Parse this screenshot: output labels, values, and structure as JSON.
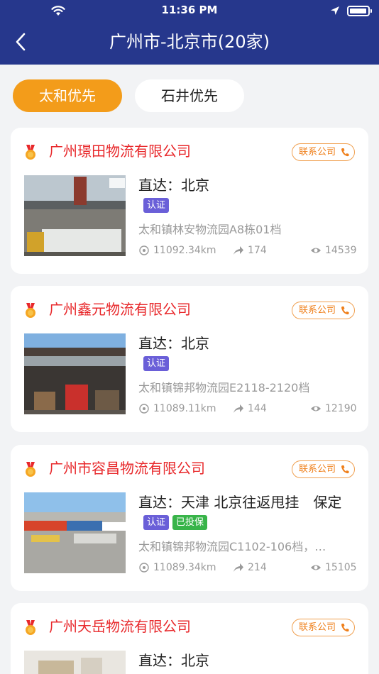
{
  "status_bar": {
    "time": "11:36 PM"
  },
  "header": {
    "title": "广州市-北京市(20家)"
  },
  "tabs": [
    {
      "label": "太和优先",
      "active": true
    },
    {
      "label": "石井优先",
      "active": false
    }
  ],
  "colors": {
    "header": "#26378c",
    "accent": "#f39c1a",
    "company_name": "#e8282b",
    "cert_badge": "#6a5fd8",
    "insured_badge": "#38b449"
  },
  "icons": {
    "back": "chevron-left-icon",
    "medal": "medal-icon",
    "phone": "phone-icon",
    "distance": "location-target-icon",
    "share": "share-arrow-icon",
    "views": "eye-icon"
  },
  "contact_label": "联系公司",
  "companies": [
    {
      "name": "广州璟田物流有限公司",
      "route": "直达：北京",
      "badges": [
        "认证"
      ],
      "address": "太和镇林安物流园A8栋01档",
      "distance": "11092.34km",
      "shares": "174",
      "views": "14539"
    },
    {
      "name": "广州鑫元物流有限公司",
      "route": "直达：北京",
      "badges": [
        "认证"
      ],
      "address": "太和镇锦邦物流园E2118-2120档",
      "distance": "11089.11km",
      "shares": "144",
      "views": "12190"
    },
    {
      "name": "广州市容昌物流有限公司",
      "route": "直达：天津 北京往返甩挂　保定",
      "badges": [
        "认证",
        "已投保"
      ],
      "address": "太和镇锦邦物流园C1102-106档，…",
      "distance": "11089.34km",
      "shares": "214",
      "views": "15105"
    },
    {
      "name": "广州天岳物流有限公司",
      "route": "直达：北京"
    }
  ]
}
